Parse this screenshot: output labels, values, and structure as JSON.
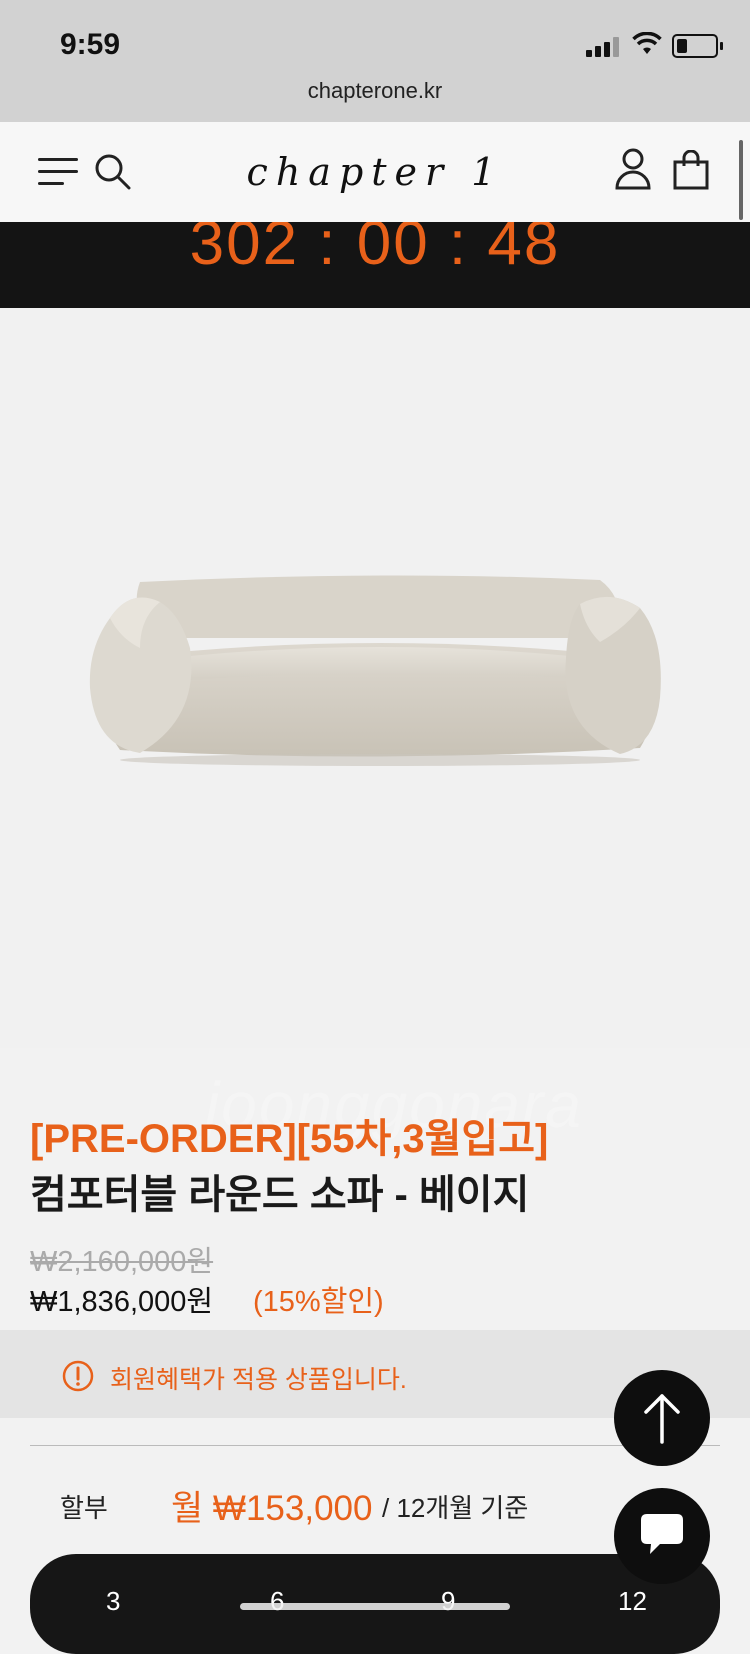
{
  "status_bar": {
    "time": "9:59",
    "url": "chapterone.kr"
  },
  "header": {
    "logo": "chapter  1"
  },
  "timer": {
    "countdown": "302 : 00 : 48"
  },
  "product": {
    "badge": "[PRE-ORDER][55차,3월입고]",
    "title": "컴포터블 라운드 소파 - 베이지",
    "original_price": "₩2,160,000원",
    "sale_price": "₩1,836,000원",
    "discount": "(15%할인)"
  },
  "notice": {
    "text": "회원혜택가 적용 상품입니다."
  },
  "installment": {
    "label": "할부",
    "amount": "월 ₩153,000",
    "basis": "/ 12개월 기준",
    "months": [
      "3",
      "6",
      "9",
      "12"
    ]
  },
  "watermark": "joonggonara",
  "colors": {
    "accent": "#e8611a",
    "dark": "#141414"
  },
  "icons": [
    "menu-icon",
    "search-icon",
    "user-icon",
    "shopping-bag-icon",
    "alert-circle-icon",
    "arrow-up-icon",
    "chat-bubble-icon"
  ]
}
